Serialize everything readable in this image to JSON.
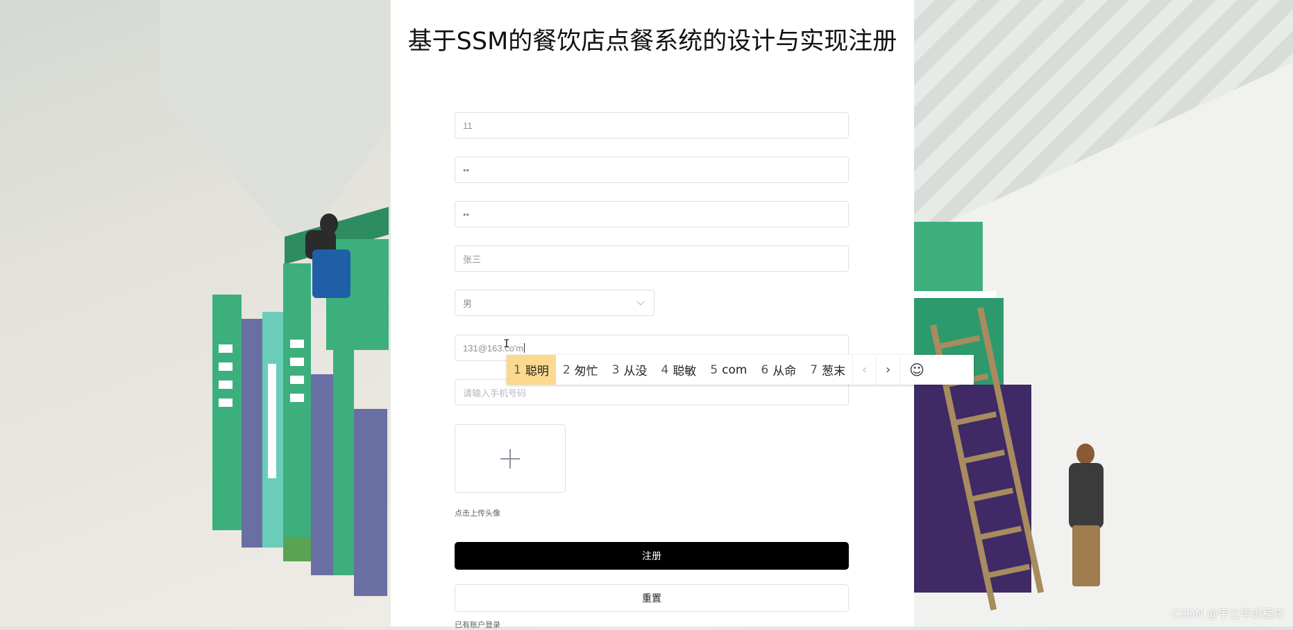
{
  "page": {
    "title": "基于SSM的餐饮店点餐系统的设计与实现注册"
  },
  "form": {
    "account_value": "11",
    "password_value": "••",
    "confirm_password_value": "••",
    "name_value": "张三",
    "gender_selected": "男",
    "email_value": "131@163.co'm",
    "phone_placeholder": "请输入手机号码",
    "avatar_hint": "点击上传头像",
    "register_label": "注册",
    "reset_label": "重置",
    "login_link": "已有账户登录"
  },
  "ime": {
    "candidates": [
      {
        "num": "1",
        "text": "聪明",
        "selected": true
      },
      {
        "num": "2",
        "text": "匆忙",
        "selected": false
      },
      {
        "num": "3",
        "text": "从没",
        "selected": false
      },
      {
        "num": "4",
        "text": "聪敏",
        "selected": false
      },
      {
        "num": "5",
        "text": "com",
        "selected": false
      },
      {
        "num": "6",
        "text": "从命",
        "selected": false
      },
      {
        "num": "7",
        "text": "葱末",
        "selected": false
      }
    ],
    "prev_icon": "chevron-left-icon",
    "next_icon": "chevron-right-icon",
    "emoji_icon": "smiley-icon"
  },
  "watermark": "CSDN @宇立毕设程序",
  "colors": {
    "primary_button": "#000000",
    "ime_selected": "#fbd98e",
    "book_green": "#3daf7d",
    "book_purple": "#6a6fa3"
  }
}
